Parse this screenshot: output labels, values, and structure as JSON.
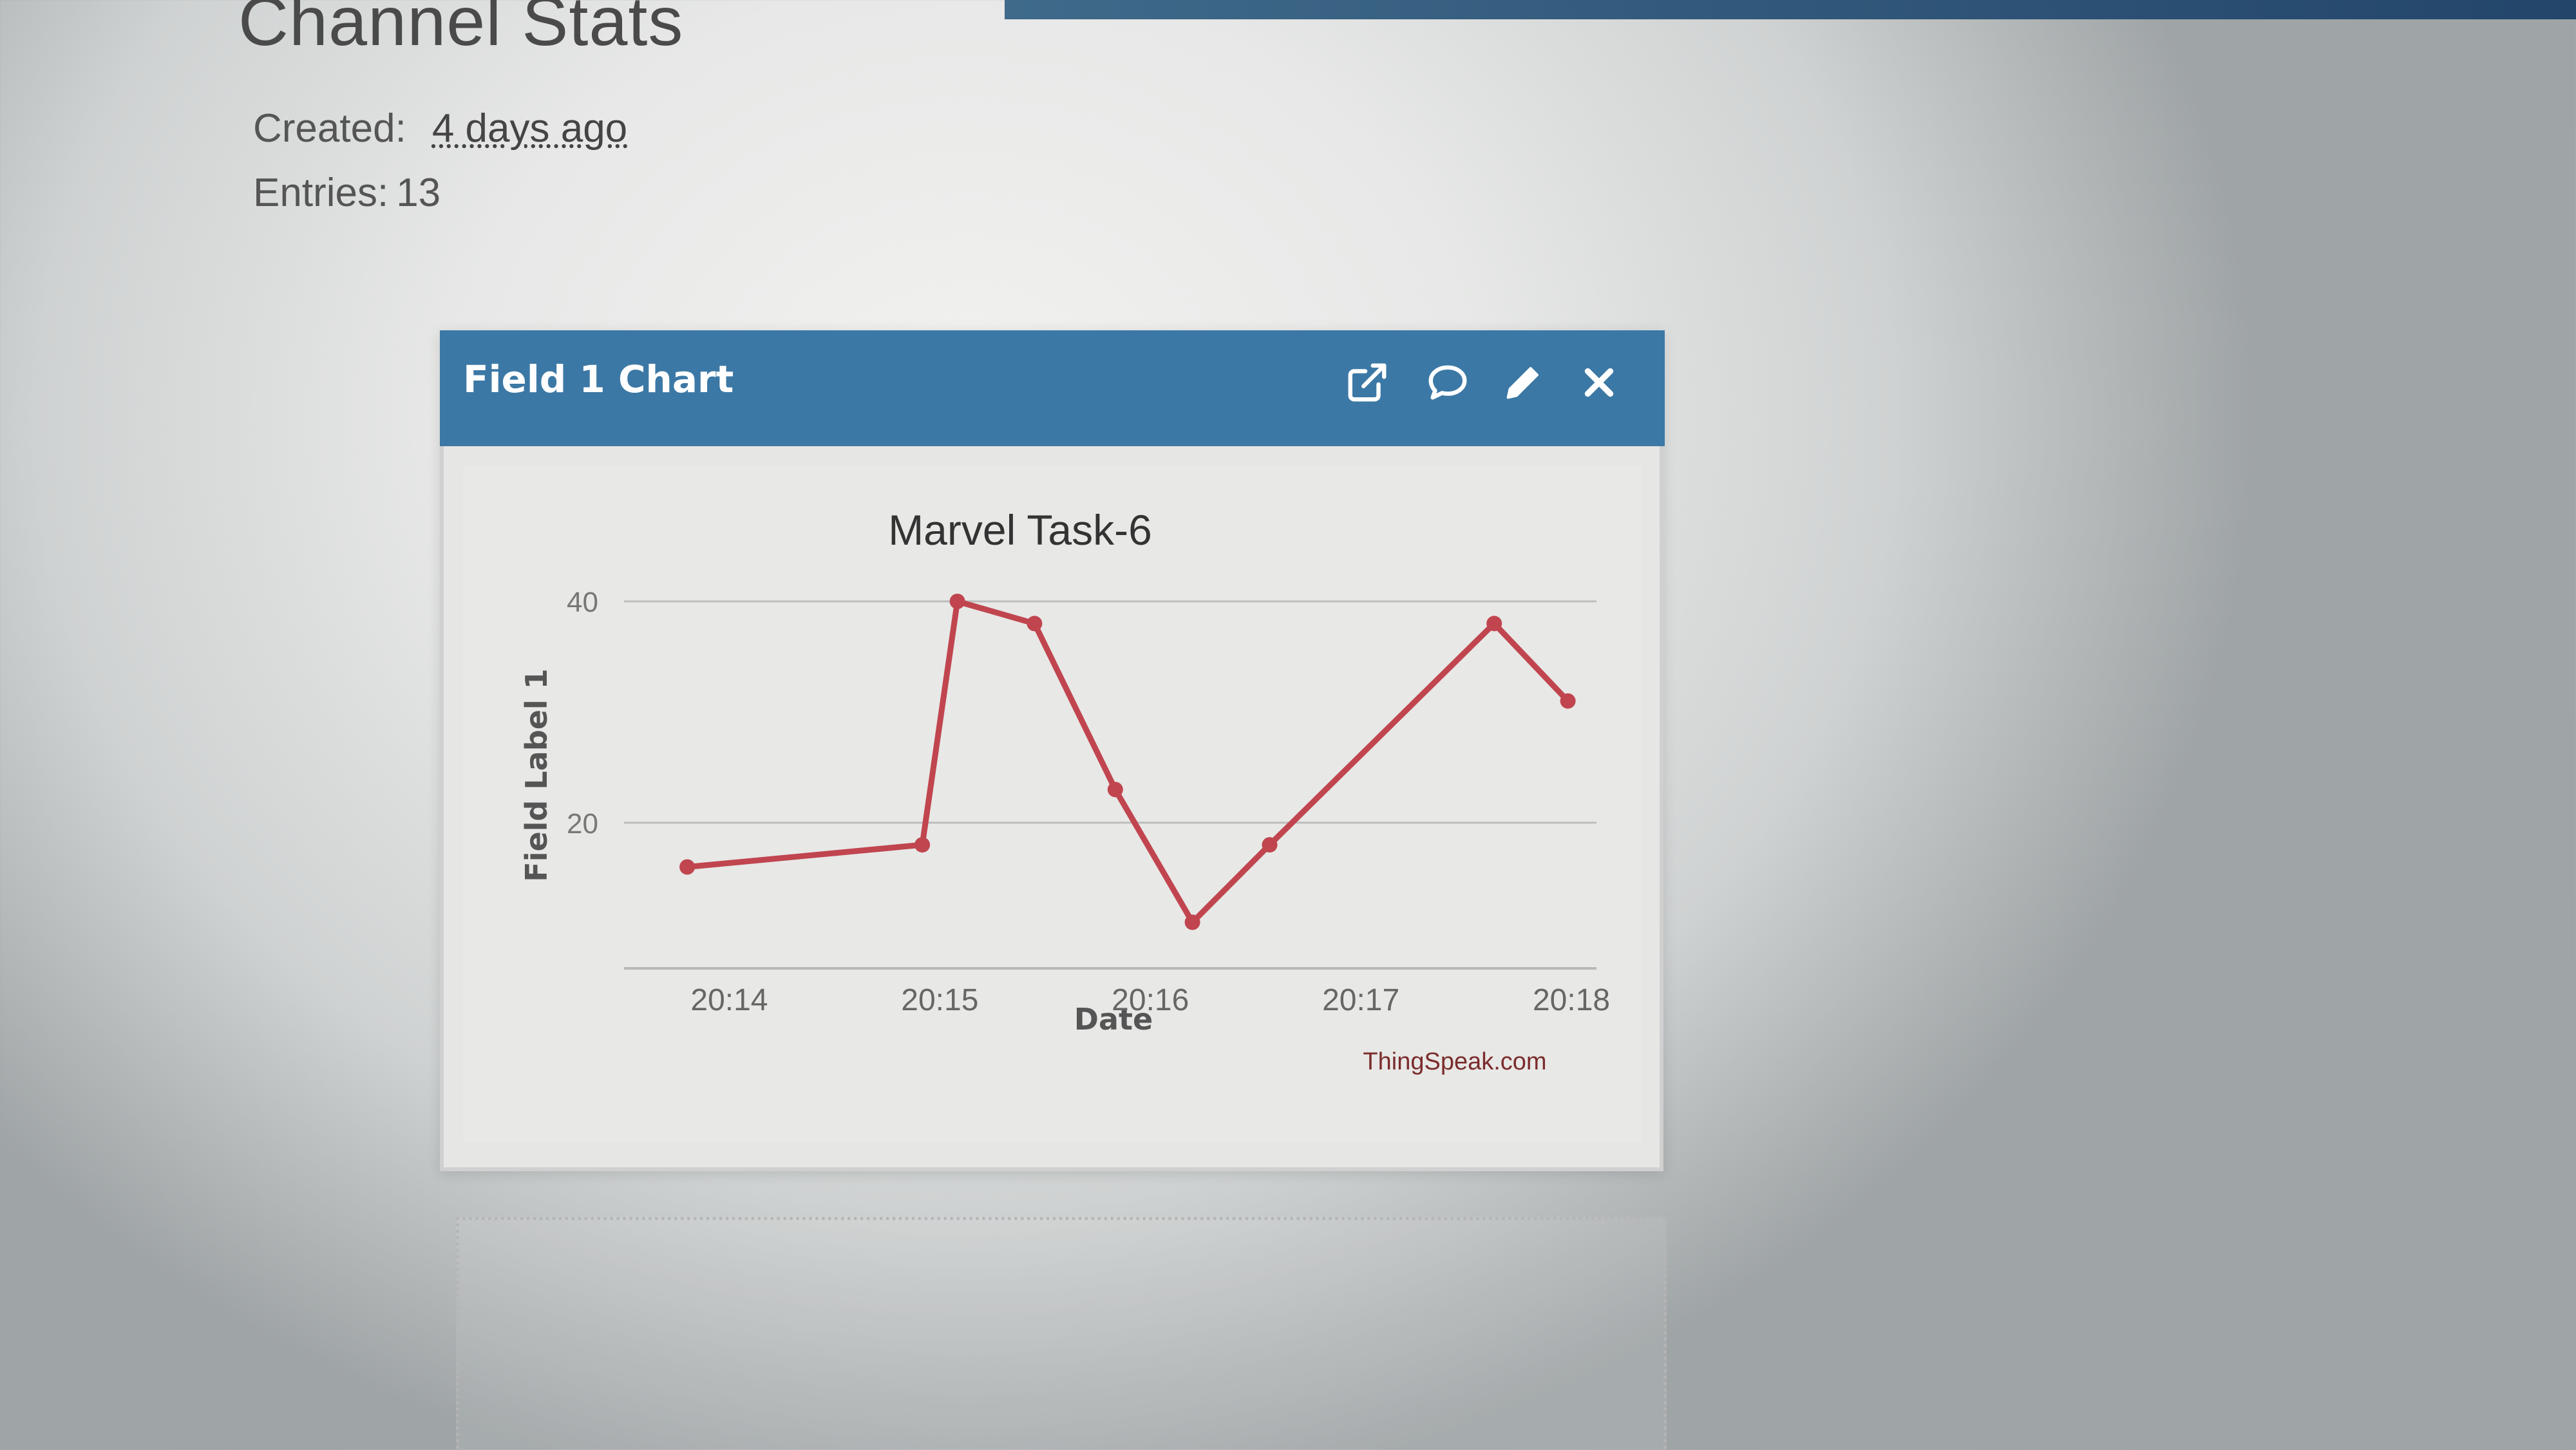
{
  "page": {
    "title": "Channel Stats",
    "created_label": "Created:",
    "created_value": "4 days ago",
    "entries_label": "Entries:",
    "entries_value": "13"
  },
  "widget": {
    "header_title": "Field 1 Chart",
    "icons": [
      "external-link-icon",
      "comment-icon",
      "pencil-icon",
      "close-icon"
    ],
    "accent_color": "#3c78a5"
  },
  "chart_data": {
    "type": "line",
    "title": "Marvel Task-6",
    "xlabel": "Date",
    "ylabel": "Field Label 1",
    "credit": "ThingSpeak.com",
    "x_ticks": [
      "20:14",
      "20:15",
      "20:16",
      "20:17",
      "20:18"
    ],
    "y_ticks": [
      20,
      40
    ],
    "ylim": [
      8,
      40
    ],
    "grid": true,
    "legend": "none",
    "series_color": "#c0454f",
    "series": [
      {
        "points": [
          {
            "x": "20:13:48",
            "y": 16
          },
          {
            "x": "20:14:55",
            "y": 18
          },
          {
            "x": "20:15:05",
            "y": 40
          },
          {
            "x": "20:15:27",
            "y": 38
          },
          {
            "x": "20:15:50",
            "y": 23
          },
          {
            "x": "20:16:12",
            "y": 11
          },
          {
            "x": "20:16:34",
            "y": 18
          },
          {
            "x": "20:17:38",
            "y": 38
          },
          {
            "x": "20:17:59",
            "y": 31
          }
        ]
      }
    ]
  }
}
